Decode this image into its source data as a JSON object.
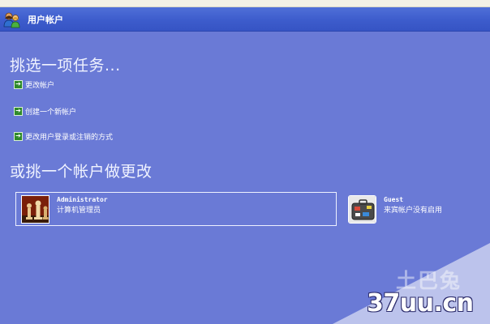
{
  "window": {
    "title": "用户帐户",
    "icon": "users-icon"
  },
  "tasks_section": {
    "heading": "挑选一项任务...",
    "items": [
      {
        "label": "更改帐户",
        "icon": "green-arrow-icon"
      },
      {
        "label": "创建一个新帐户",
        "icon": "green-arrow-icon"
      },
      {
        "label": "更改用户登录或注销的方式",
        "icon": "green-arrow-icon"
      }
    ]
  },
  "accounts_section": {
    "heading": "或挑一个帐户做更改",
    "accounts": [
      {
        "name": "Administrator",
        "description": "计算机管理员",
        "picture": "chess-pieces-picture"
      },
      {
        "name": "Guest",
        "description": "来宾帐户没有启用",
        "picture": "suitcase-picture"
      }
    ]
  },
  "watermark": {
    "cn": "土巴兔",
    "site": "37uu.cn"
  },
  "colors": {
    "background": "#6a7ad6",
    "titlebar": "#3d5ccc",
    "task_icon": "#2f8a2a"
  }
}
